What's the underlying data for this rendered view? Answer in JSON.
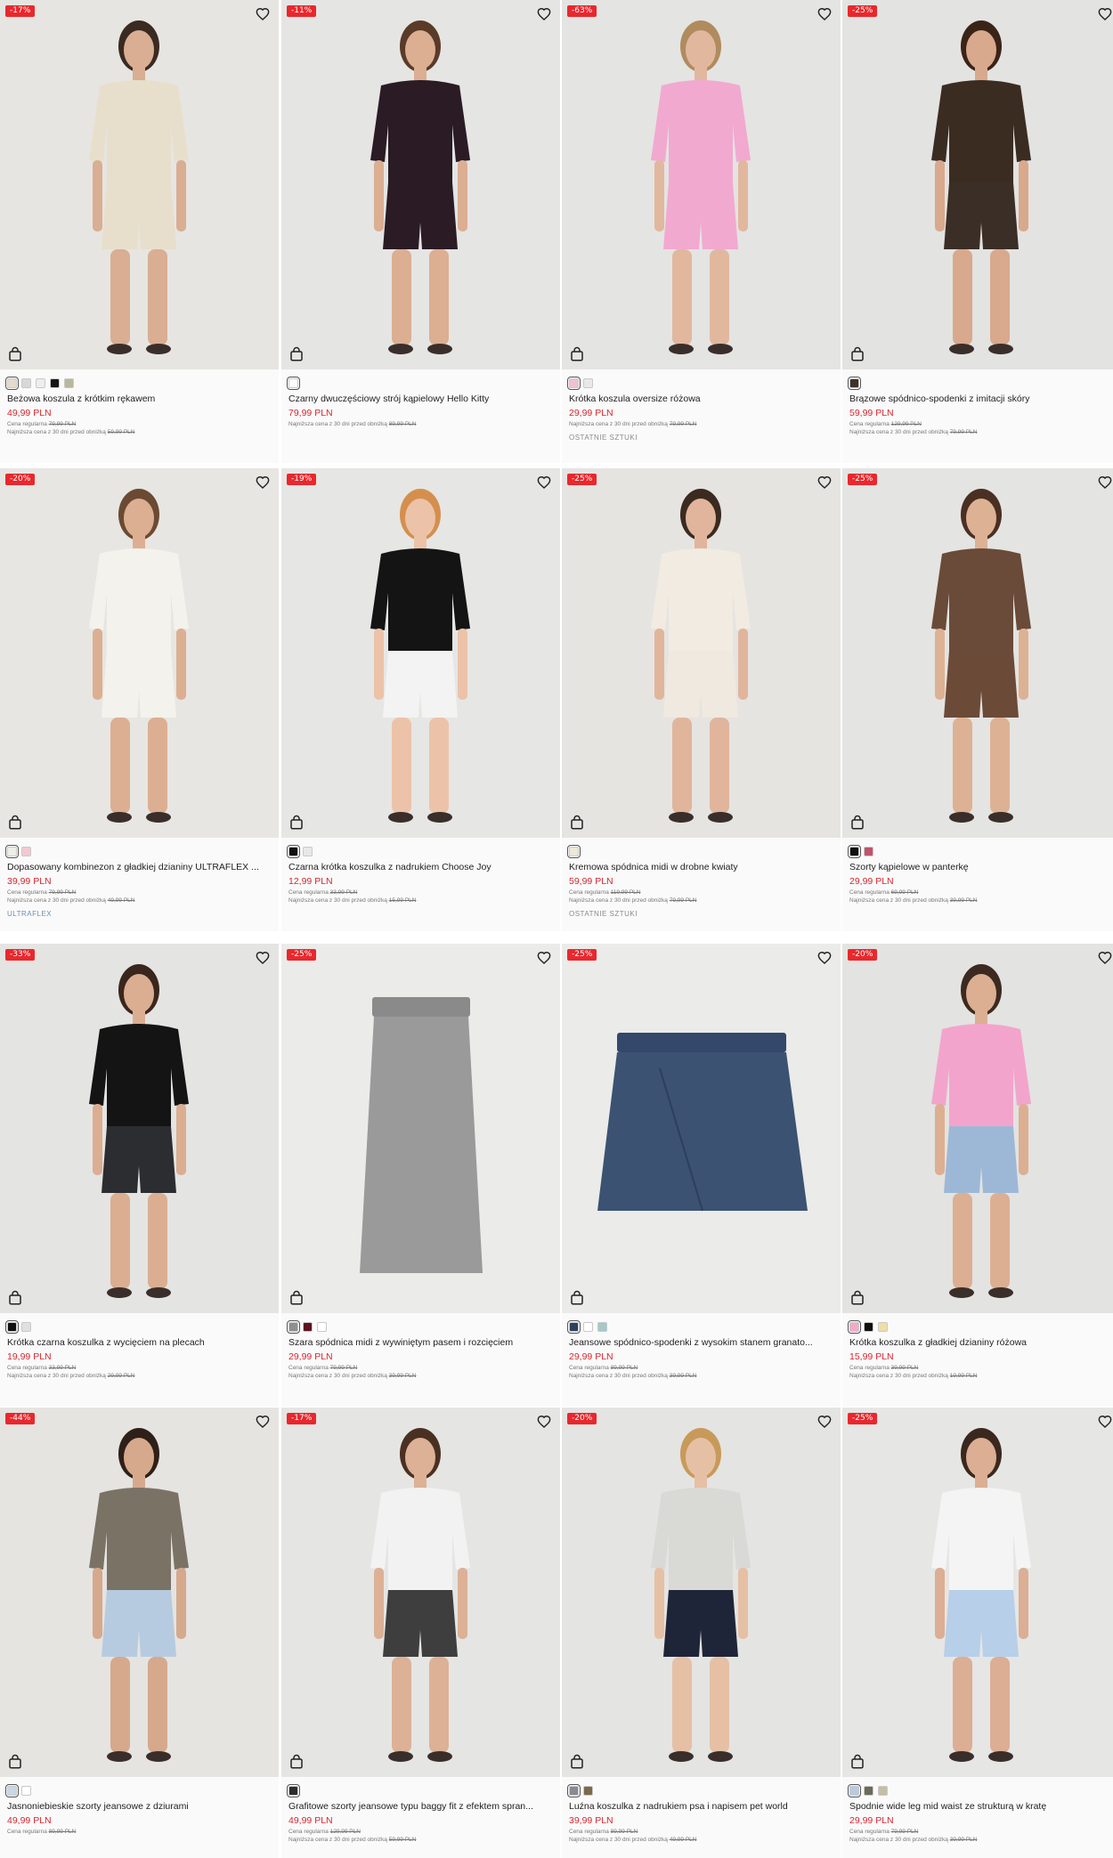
{
  "products": [
    {
      "badge": "-17%",
      "name": "Beżowa koszula z krótkim rękawem",
      "price": "49,99 PLN",
      "regular_label": "Cena regularna",
      "regular_price": "79,99 PLN",
      "lowest_label": "Najniższa cena z 30 dni przed obniżką",
      "lowest_price": "59,99 PLN",
      "tag": "",
      "swatches": [
        "#e3dccb",
        "#d8d8d8",
        "#eeeeee",
        "#151515",
        "#b9b89a"
      ],
      "bg": "#e6e5e1",
      "top": "#e7dfcc",
      "bottom": "#e7dfcc",
      "skin": "#d9ae93",
      "hair": "#3a2a22"
    },
    {
      "badge": "-11%",
      "name": "Czarny dwuczęściowy strój kąpielowy Hello Kitty",
      "price": "79,99 PLN",
      "regular_label": "",
      "regular_price": "",
      "lowest_label": "Najniższa cena z 30 dni przed obniżką",
      "lowest_price": "89,99 PLN",
      "tag": "",
      "swatches": [
        "#ffffff"
      ],
      "bg": "#e5e5e3",
      "top": "#2a1b25",
      "bottom": "#2a1b25",
      "skin": "#dcae92",
      "hair": "#5a3a28"
    },
    {
      "badge": "-63%",
      "name": "Krótka koszula oversize różowa",
      "price": "29,99 PLN",
      "regular_label": "",
      "regular_price": "",
      "lowest_label": "Najniższa cena z 30 dni przed obniżką",
      "lowest_price": "79,99 PLN",
      "tag": "OSTATNIE SZTUKI",
      "swatches": [
        "#f3bfd6",
        "#e8e8e8"
      ],
      "bg": "#e4e4e2",
      "top": "#f1a9d0",
      "bottom": "#f1a9d0",
      "skin": "#e1b89e",
      "hair": "#b08b5e"
    },
    {
      "badge": "-25%",
      "name": "Brązowe spódnico-spodenki z imitacji skóry",
      "price": "59,99 PLN",
      "regular_label": "Cena regularna",
      "regular_price": "129,99 PLN",
      "lowest_label": "Najniższa cena z 30 dni przed obniżką",
      "lowest_price": "79,99 PLN",
      "tag": "",
      "swatches": [
        "#3e3128"
      ],
      "bg": "#e3e3e1",
      "top": "#3b2c22",
      "bottom": "#3a2e26",
      "skin": "#d8a98d",
      "hair": "#3a2418"
    },
    {
      "badge": "-20%",
      "name": "Dopasowany kombinezon z gładkiej dzianiny ULTRAFLEX ...",
      "price": "39,99 PLN",
      "regular_label": "Cena regularna",
      "regular_price": "79,99 PLN",
      "lowest_label": "Najniższa cena z 30 dni przed obniżką",
      "lowest_price": "49,99 PLN",
      "tag": "ULTRAFLEX",
      "swatches": [
        "#efeee6",
        "#f2c9d2"
      ],
      "bg": "#e7e6e3",
      "top": "#f4f2ec",
      "bottom": "#f4f2ec",
      "skin": "#dcaf92",
      "hair": "#6a4a32"
    },
    {
      "badge": "-19%",
      "name": "Czarna krótka koszulka z nadrukiem Choose Joy",
      "price": "12,99 PLN",
      "regular_label": "Cena regularna",
      "regular_price": "33,99 PLN",
      "lowest_label": "Najniższa cena z 30 dni przed obniżką",
      "lowest_price": "15,99 PLN",
      "tag": "",
      "swatches": [
        "#111111",
        "#e8e8e8"
      ],
      "bg": "#e6e6e4",
      "top": "#141414",
      "bottom": "#f3f3f3",
      "skin": "#ecc3a8",
      "hair": "#d48f4e"
    },
    {
      "badge": "-25%",
      "name": "Kremowa spódnica midi w drobne kwiaty",
      "price": "59,99 PLN",
      "regular_label": "Cena regularna",
      "regular_price": "119,99 PLN",
      "lowest_label": "Najniższa cena z 30 dni przed obniżką",
      "lowest_price": "79,99 PLN",
      "tag": "OSTATNIE SZTUKI",
      "swatches": [
        "#efe7d8"
      ],
      "bg": "#e5e4e1",
      "top": "#f1ebe1",
      "bottom": "#f0e9df",
      "skin": "#e0b59b",
      "hair": "#3a2a20"
    },
    {
      "badge": "-25%",
      "name": "Szorty kąpielowe w panterkę",
      "price": "29,99 PLN",
      "regular_label": "Cena regularna",
      "regular_price": "69,99 PLN",
      "lowest_label": "Najniższa cena z 30 dni przed obniżką",
      "lowest_price": "39,99 PLN",
      "tag": "",
      "swatches": [
        "#111111",
        "#c0536d"
      ],
      "bg": "#e4e4e2",
      "top": "#6a4a38",
      "bottom": "#6b4a38",
      "skin": "#ddb294",
      "hair": "#4a3022"
    },
    {
      "badge": "-33%",
      "name": "Krótka czarna koszulka z wycięciem na plecach",
      "price": "19,99 PLN",
      "regular_label": "Cena regularna",
      "regular_price": "33,99 PLN",
      "lowest_label": "Najniższa cena z 30 dni przed obniżką",
      "lowest_price": "29,99 PLN",
      "tag": "",
      "swatches": [
        "#111111",
        "#e0e0e0"
      ],
      "bg": "#e4e4e2",
      "top": "#141414",
      "bottom": "#2b2d30",
      "skin": "#dbae92",
      "hair": "#3a261c"
    },
    {
      "badge": "-25%",
      "name": "Szara spódnica midi z wywiniętym pasem i rozcięciem",
      "price": "29,99 PLN",
      "regular_label": "Cena regularna",
      "regular_price": "79,99 PLN",
      "lowest_label": "Najniższa cena z 30 dni przed obniżką",
      "lowest_price": "39,99 PLN",
      "tag": "",
      "swatches": [
        "#8f8f8f",
        "#5b1420",
        "#ffffff"
      ],
      "bg": "#ebebe9",
      "top": "#9a9a9a",
      "bottom": "#9a9a9a",
      "skin": "",
      "hair": ""
    },
    {
      "badge": "-25%",
      "name": "Jeansowe spódnico-spodenki z wysokim stanem granato...",
      "price": "29,99 PLN",
      "regular_label": "Cena regularna",
      "regular_price": "89,99 PLN",
      "lowest_label": "Najniższa cena z 30 dni przed obniżką",
      "lowest_price": "39,99 PLN",
      "tag": "",
      "swatches": [
        "#2e405e",
        "#ffffff",
        "#a7c8c7"
      ],
      "bg": "#ebebe9",
      "top": "#3b5272",
      "bottom": "#3b5272",
      "skin": "",
      "hair": ""
    },
    {
      "badge": "-20%",
      "name": "Krótka koszulka z gładkiej dzianiny różowa",
      "price": "15,99 PLN",
      "regular_label": "Cena regularna",
      "regular_price": "39,99 PLN",
      "lowest_label": "Najniższa cena z 30 dni przed obniżką",
      "lowest_price": "19,99 PLN",
      "tag": "",
      "swatches": [
        "#f3a9c9",
        "#111111",
        "#f1dea6"
      ],
      "bg": "#e3e3e1",
      "top": "#f3a4cc",
      "bottom": "#9db8d6",
      "skin": "#dcaf92",
      "hair": "#3c2a20"
    },
    {
      "badge": "-44%",
      "name": "Jasnoniebieskie szorty jeansowe z dziurami",
      "price": "49,99 PLN",
      "regular_label": "Cena regularna",
      "regular_price": "89,99 PLN",
      "lowest_label": "",
      "lowest_price": "",
      "tag": "",
      "swatches": [
        "#c9d8e6",
        "#ffffff"
      ],
      "bg": "#e5e4e1",
      "top": "#7b7266",
      "bottom": "#b6cbe0",
      "skin": "#d6a98d",
      "hair": "#2e2018"
    },
    {
      "badge": "-17%",
      "name": "Grafitowe szorty jeansowe typu baggy fit z efektem spran...",
      "price": "49,99 PLN",
      "regular_label": "Cena regularna",
      "regular_price": "129,99 PLN",
      "lowest_label": "Najniższa cena z 30 dni przed obniżką",
      "lowest_price": "59,99 PLN",
      "tag": "",
      "swatches": [
        "#2c2c2c"
      ],
      "bg": "#e5e5e3",
      "top": "#f2f2f2",
      "bottom": "#3e3e3e",
      "skin": "#dcb196",
      "hair": "#4a3022"
    },
    {
      "badge": "-20%",
      "name": "Luźna koszulka z nadrukiem psa i napisem pet world",
      "price": "39,99 PLN",
      "regular_label": "Cena regularna",
      "regular_price": "89,99 PLN",
      "lowest_label": "Najniższa cena z 30 dni przed obniżką",
      "lowest_price": "49,99 PLN",
      "tag": "",
      "swatches": [
        "#8a8a92",
        "#7a6a4a"
      ],
      "bg": "#e4e4e2",
      "top": "#d9d9d6",
      "bottom": "#1f2538",
      "skin": "#e6c0a4",
      "hair": "#c89a5a"
    },
    {
      "badge": "-25%",
      "name": "Spodnie wide leg mid waist ze strukturą w kratę",
      "price": "29,99 PLN",
      "regular_label": "Cena regularna",
      "regular_price": "79,99 PLN",
      "lowest_label": "Najniższa cena z 30 dni przed obniżką",
      "lowest_price": "39,99 PLN",
      "tag": "",
      "swatches": [
        "#b7cbe3",
        "#6d6a55",
        "#c3c0a2"
      ],
      "bg": "#e6e6e4",
      "top": "#f4f4f4",
      "bottom": "#b7cfe8",
      "skin": "#dcae94",
      "hair": "#3a281e"
    }
  ]
}
